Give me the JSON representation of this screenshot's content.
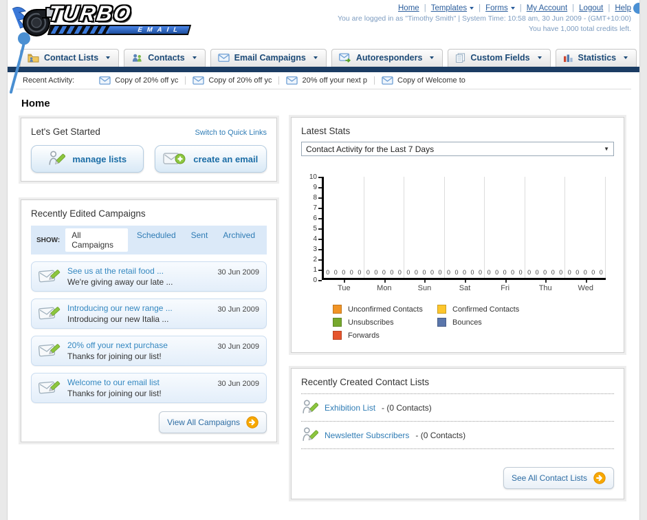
{
  "logo": {
    "title": "TURBO",
    "subtitle": "EMAIL"
  },
  "header": {
    "links": [
      {
        "label": "Home",
        "dropdown": false
      },
      {
        "label": "Templates",
        "dropdown": true
      },
      {
        "label": "Forms",
        "dropdown": true
      },
      {
        "label": "My Account",
        "dropdown": false
      },
      {
        "label": "Logout",
        "dropdown": false
      },
      {
        "label": "Help",
        "dropdown": false
      }
    ],
    "status_line1": "You are logged in as \"Timothy Smith\" | System Time: 10:58 am, 30 Jun 2009 - (GMT+10:00)",
    "status_line2": "You have 1,000 total credits left."
  },
  "nav": {
    "tabs": [
      {
        "label": "Contact Lists",
        "icon": "folder-contacts-icon"
      },
      {
        "label": "Contacts",
        "icon": "people-icon"
      },
      {
        "label": "Email Campaigns",
        "icon": "envelope-icon"
      },
      {
        "label": "Autoresponders",
        "icon": "envelope-arrow-icon"
      },
      {
        "label": "Custom Fields",
        "icon": "pages-icon"
      },
      {
        "label": "Statistics",
        "icon": "bar-chart-icon"
      }
    ]
  },
  "recent_activity": {
    "label": "Recent Activity:",
    "items": [
      "Copy of 20% off yc",
      "Copy of 20% off yc",
      "20% off your next p",
      "Copy of Welcome to"
    ]
  },
  "page": {
    "title": "Home"
  },
  "get_started": {
    "title": "Let's Get Started",
    "switch_link": "Switch to Quick Links",
    "buttons": [
      {
        "label": "manage lists"
      },
      {
        "label": "create an email"
      }
    ]
  },
  "campaigns": {
    "title": "Recently Edited Campaigns",
    "filter_label": "SHOW:",
    "filters": [
      "All Campaigns",
      "Scheduled",
      "Sent",
      "Archived"
    ],
    "active_filter": "All Campaigns",
    "items": [
      {
        "title": "See us at the retail food ...",
        "subtitle": "We're giving away our late ...",
        "date": "30 Jun 2009"
      },
      {
        "title": "Introducing our new range ...",
        "subtitle": "Introducing our new Italia ...",
        "date": "30 Jun 2009"
      },
      {
        "title": "20% off your next purchase",
        "subtitle": "Thanks for joining our list!",
        "date": "30 Jun 2009"
      },
      {
        "title": "Welcome to our email list",
        "subtitle": "Thanks for joining our list!",
        "date": "30 Jun 2009"
      }
    ],
    "view_all_label": "View All Campaigns"
  },
  "stats": {
    "title": "Latest Stats",
    "dropdown_value": "Contact Activity for the Last 7 Days"
  },
  "chart_data": {
    "type": "bar",
    "categories": [
      "Tue",
      "Mon",
      "Sun",
      "Sat",
      "Fri",
      "Thu",
      "Wed"
    ],
    "series": [
      {
        "name": "Unconfirmed Contacts",
        "color": "#f19426",
        "values": [
          0,
          0,
          0,
          0,
          0,
          0,
          0
        ]
      },
      {
        "name": "Confirmed Contacts",
        "color": "#fdc62c",
        "values": [
          0,
          0,
          0,
          0,
          0,
          0,
          0
        ]
      },
      {
        "name": "Unsubscribes",
        "color": "#76a82d",
        "values": [
          0,
          0,
          0,
          0,
          0,
          0,
          0
        ]
      },
      {
        "name": "Bounces",
        "color": "#5a76ab",
        "values": [
          0,
          0,
          0,
          0,
          0,
          0,
          0
        ]
      },
      {
        "name": "Forwards",
        "color": "#e5552d",
        "values": [
          0,
          0,
          0,
          0,
          0,
          0,
          0
        ]
      }
    ],
    "ylim": [
      0,
      10
    ],
    "yticks": [
      0,
      1,
      2,
      3,
      4,
      5,
      6,
      7,
      8,
      9,
      10
    ],
    "grid": true,
    "legend_position": "bottom"
  },
  "contact_lists": {
    "title": "Recently Created Contact Lists",
    "items": [
      {
        "name": "Exhibition List",
        "suffix": " - (0 Contacts)"
      },
      {
        "name": "Newsletter Subscribers",
        "suffix": " - (0 Contacts)"
      }
    ],
    "see_all_label": "See All Contact Lists"
  }
}
